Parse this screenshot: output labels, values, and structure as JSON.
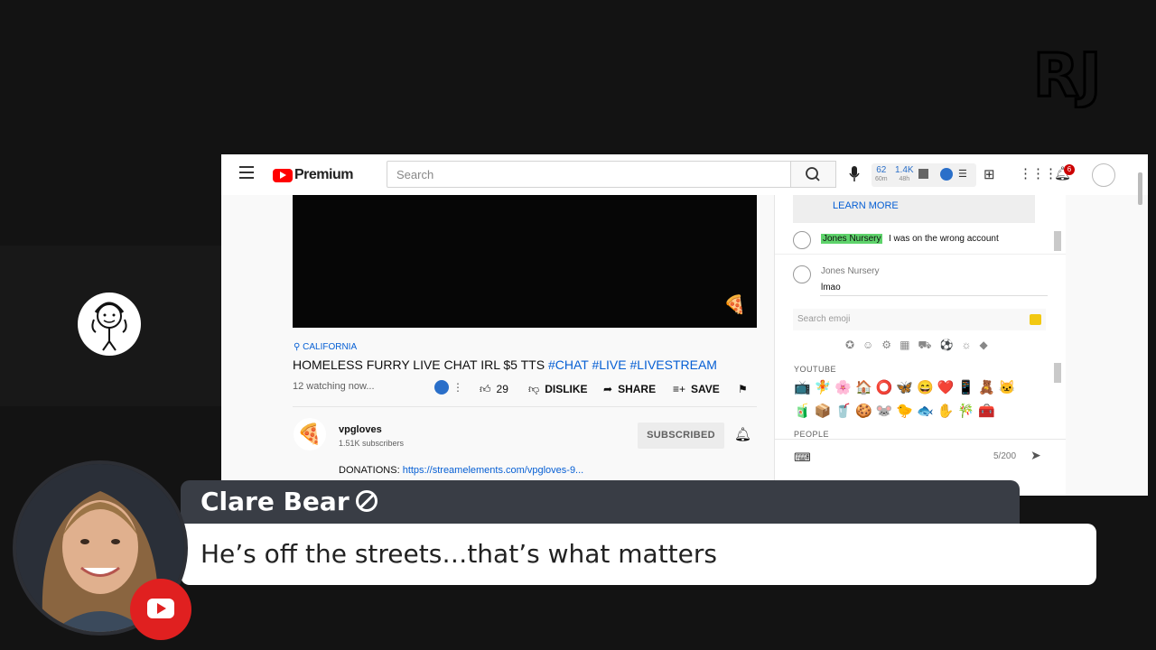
{
  "header": {
    "brand": "Premium",
    "search_placeholder": "Search",
    "stats": [
      {
        "value": "62",
        "sub": "60m"
      },
      {
        "value": "1.4K",
        "sub": "48h"
      }
    ],
    "notification_count": "6"
  },
  "video": {
    "location": "CALIFORNIA",
    "title": "HOMELESS FURRY LIVE CHAT IRL $5 TTS",
    "hashtags": [
      "#CHAT",
      "#LIVE",
      "#LIVESTREAM"
    ],
    "watching": "12 watching now...",
    "like_count": "29",
    "dislike_label": "DISLIKE",
    "share_label": "SHARE",
    "save_label": "SAVE"
  },
  "channel": {
    "name": "vpgloves",
    "subscribers": "1.51K subscribers",
    "subscribed_label": "SUBSCRIBED",
    "donations_label": "DONATIONS:",
    "donations_link": "https://streamelements.com/vpgloves-9..."
  },
  "chat": {
    "learn_more": "LEARN MORE",
    "messages": [
      {
        "author": "Jones Nursery",
        "text": "I was on the wrong account"
      },
      {
        "author": "Jones Nursery",
        "text": "lmao"
      }
    ],
    "emoji_search_placeholder": "Search emoji",
    "emoji_section": "YOUTUBE",
    "emoji_row1": "📺🧚🌸🏠⭕🦋😄❤️📱🧸🐱",
    "emoji_row2": "🧃📦🥤🍪🐭🐤🐟✋🎋🧰",
    "people_section": "PEOPLE",
    "char_count": "5/200"
  },
  "overlay": {
    "commenter_name": "Clare Bear",
    "comment": "He’s off the streets…that’s what matters"
  },
  "logo_text": "RJ"
}
